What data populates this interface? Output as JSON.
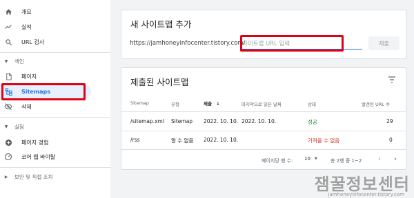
{
  "sidebar": {
    "items": [
      {
        "label": "개요",
        "icon": "home-icon"
      },
      {
        "label": "실적",
        "icon": "trending-up-icon"
      },
      {
        "label": "URL 검사",
        "icon": "search-icon"
      }
    ],
    "sections": {
      "index": {
        "label": "색인",
        "items": [
          {
            "label": "페이지",
            "icon": "page-icon"
          },
          {
            "label": "Sitemaps",
            "icon": "sitemap-icon"
          },
          {
            "label": "삭제",
            "icon": "eye-off-icon"
          }
        ]
      },
      "experience": {
        "label": "실험",
        "items": [
          {
            "label": "페이지 경험",
            "icon": "plus-circle-icon"
          },
          {
            "label": "코어 웹 바이탈",
            "icon": "speedometer-icon"
          }
        ]
      },
      "security": {
        "label": "보안 및 직접 조치"
      }
    }
  },
  "add_sitemap": {
    "title": "새 사이트맵 추가",
    "url_prefix": "https://jamhoneyinfocenter.tistory.com/",
    "input_placeholder": "사이트맵 URL 입력",
    "submit_label": "제출"
  },
  "submitted": {
    "title": "제출된 사이트맵",
    "columns": [
      "Sitemap",
      "유형",
      "제출",
      "마지막으로 읽은 날짜",
      "상태",
      "발견된 URL 수"
    ],
    "rows": [
      {
        "sitemap": "/sitemap.xml",
        "type": "Sitemap",
        "submitted": "2022. 10. 10.",
        "last_read": "2022. 10. 10.",
        "status": "성공",
        "urls": "29"
      },
      {
        "sitemap": "/rss",
        "type": "알 수 없음",
        "submitted": "2022. 10. 10.",
        "last_read": "",
        "status": "가져올 수 없음",
        "urls": "0"
      }
    ],
    "pager": {
      "rows_per_page_label": "페이지당 행 수:",
      "rows_per_page": "10",
      "range": "총 2행 중 1~2"
    }
  },
  "watermark": {
    "text": "잼꿀정보센터",
    "sub": "jamhoneyinfocenter.tistory.com"
  },
  "colors": {
    "accent": "#1a73e8",
    "highlight": "#e00012",
    "success": "#188038",
    "error": "#d93025"
  }
}
